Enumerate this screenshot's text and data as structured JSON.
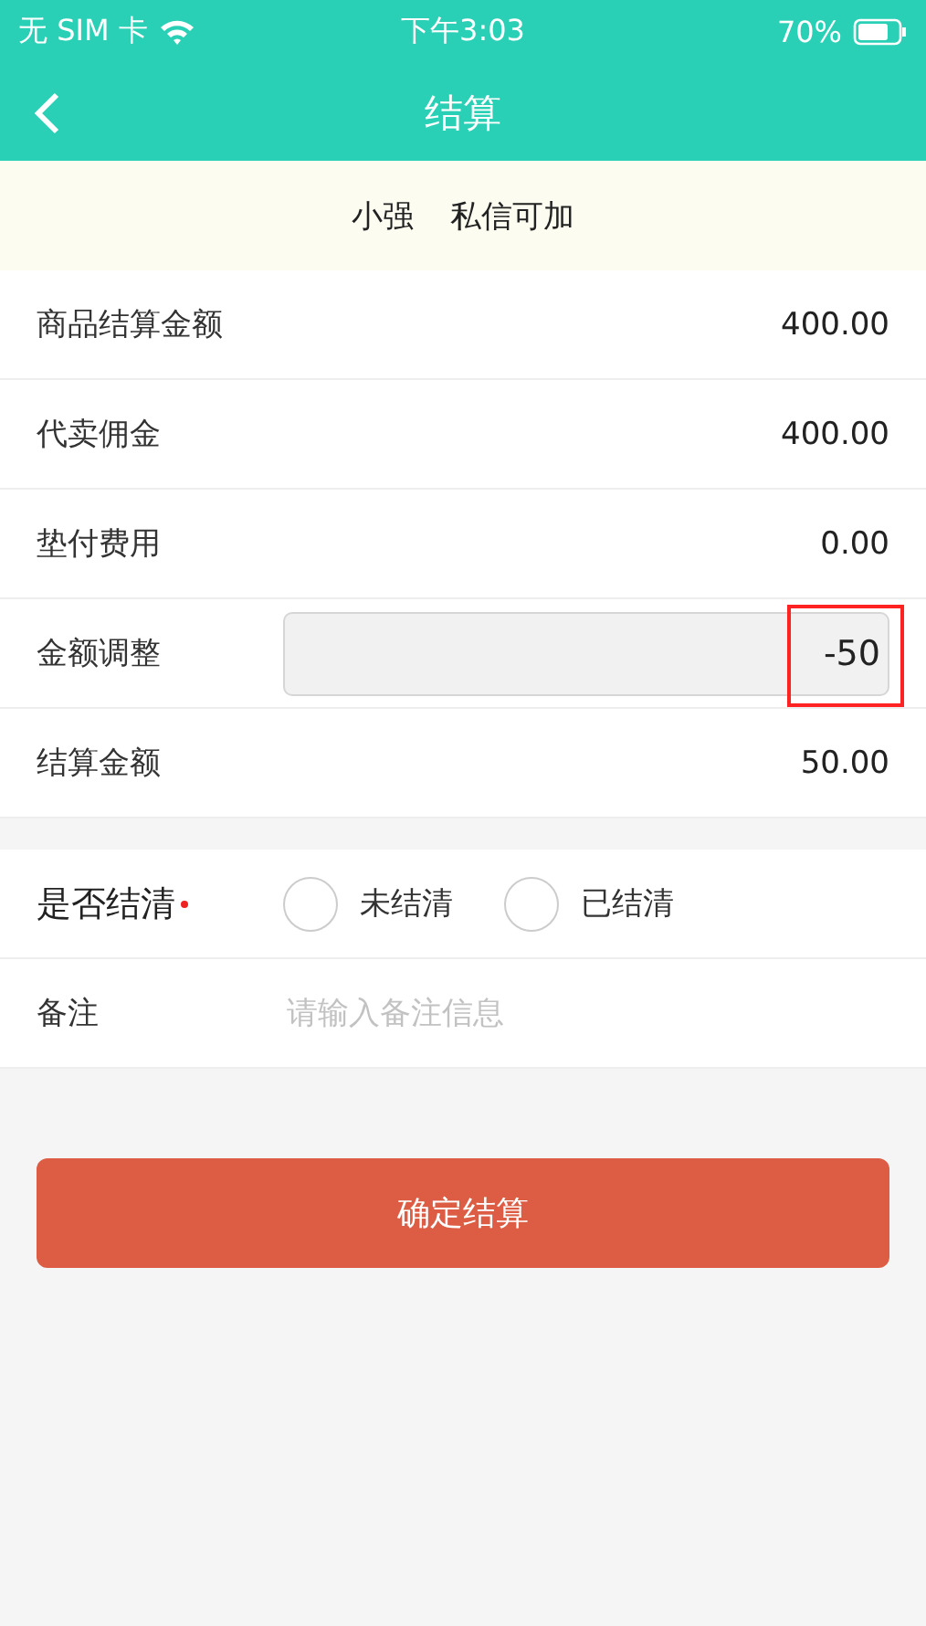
{
  "status_bar": {
    "carrier": "无 SIM 卡",
    "time": "下午3:03",
    "battery": "70%"
  },
  "nav": {
    "title": "结算"
  },
  "notice": {
    "name": "小强",
    "message": "私信可加"
  },
  "rows": [
    {
      "kind": "text",
      "label": "商品结算金额",
      "value": "400.00"
    },
    {
      "kind": "text",
      "label": "代卖佣金",
      "value": "400.00"
    },
    {
      "kind": "text",
      "label": "垫付费用",
      "value": "0.00"
    },
    {
      "kind": "input",
      "label": "金额调整",
      "value": "-50",
      "highlighted": true
    },
    {
      "kind": "text",
      "label": "结算金额",
      "value": "50.00"
    }
  ],
  "settled": {
    "label": "是否结清",
    "required": true,
    "options": [
      {
        "label": "未结清",
        "selected": false
      },
      {
        "label": "已结清",
        "selected": false
      }
    ]
  },
  "remarks": {
    "label": "备注",
    "placeholder": "请输入备注信息"
  },
  "submit": "确定结算"
}
